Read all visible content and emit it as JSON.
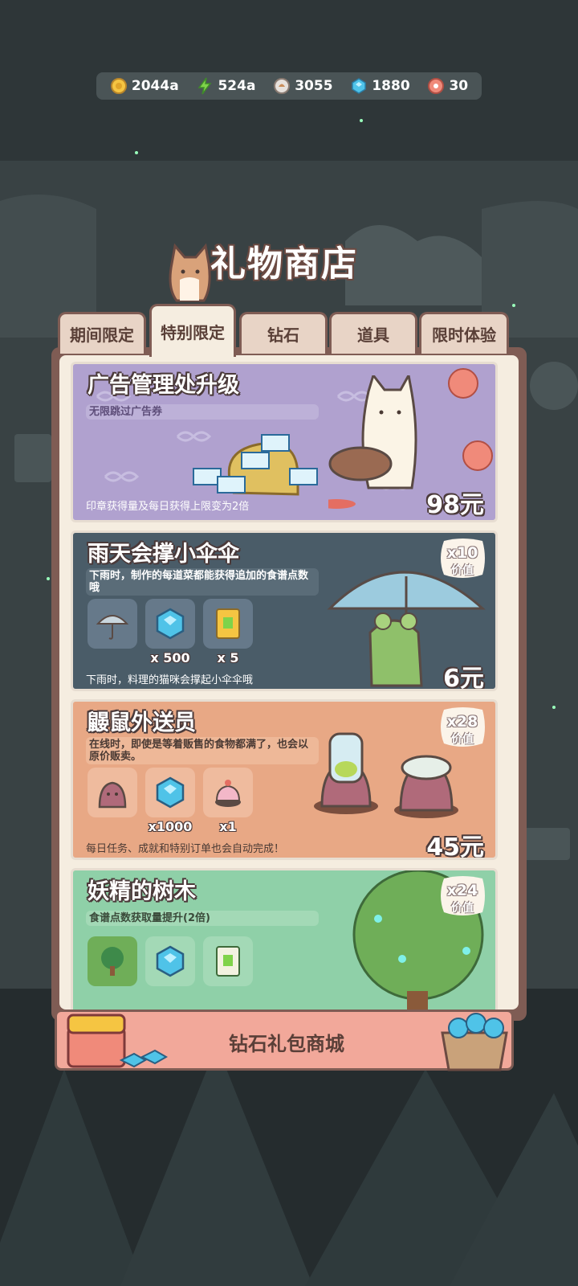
{
  "resources": [
    {
      "icon": "gold-coin-icon",
      "value": "2044a"
    },
    {
      "icon": "energy-bolt-icon",
      "value": "524a"
    },
    {
      "icon": "recipe-point-icon",
      "value": "3055"
    },
    {
      "icon": "diamond-icon",
      "value": "1880"
    },
    {
      "icon": "cookie-ticket-icon",
      "value": "30"
    }
  ],
  "shop": {
    "title": "礼物商店"
  },
  "tabs": [
    {
      "label": "期间限定",
      "active": false
    },
    {
      "label": "特别限定",
      "active": true
    },
    {
      "label": "钻石",
      "active": false
    },
    {
      "label": "道具",
      "active": false
    },
    {
      "label": "限时体验",
      "active": false
    }
  ],
  "cards": [
    {
      "title": "广告管理处升级",
      "desc": "无限跳过广告券",
      "footer": "印章获得量及每日获得上限变为2倍",
      "price": "98元",
      "color": "#b0a1cf"
    },
    {
      "title": "雨天会撑小伞伞",
      "desc": "下雨时，制作的每道菜都能获得追加的食谱点数哦",
      "footer": "下雨时，料理的猫咪会撑起小伞伞哦",
      "price": "6元",
      "badge_value": "x10",
      "badge_label": "价值",
      "items": [
        {
          "icon": "umbrella-icon",
          "qty": ""
        },
        {
          "icon": "diamond-icon",
          "qty": "x 500"
        },
        {
          "icon": "gold-ticket-icon",
          "qty": "x 5"
        }
      ]
    },
    {
      "title": "鼹鼠外送员",
      "desc": "在线时，即使是等着贩售的食物都满了，也会以原价贩卖。",
      "footer": "每日任务、成就和特别订单也会自动完成！",
      "price": "45元",
      "badge_value": "x28",
      "badge_label": "价值",
      "items": [
        {
          "icon": "mole-icon",
          "qty": ""
        },
        {
          "icon": "diamond-icon",
          "qty": "x1000"
        },
        {
          "icon": "cake-icon",
          "qty": "x1"
        }
      ]
    },
    {
      "title": "妖精的树木",
      "desc": "食谱点数获取量提升(2倍)",
      "badge_value": "x24",
      "badge_label": "价值"
    }
  ],
  "mall": {
    "label": "钻石礼包商城"
  }
}
